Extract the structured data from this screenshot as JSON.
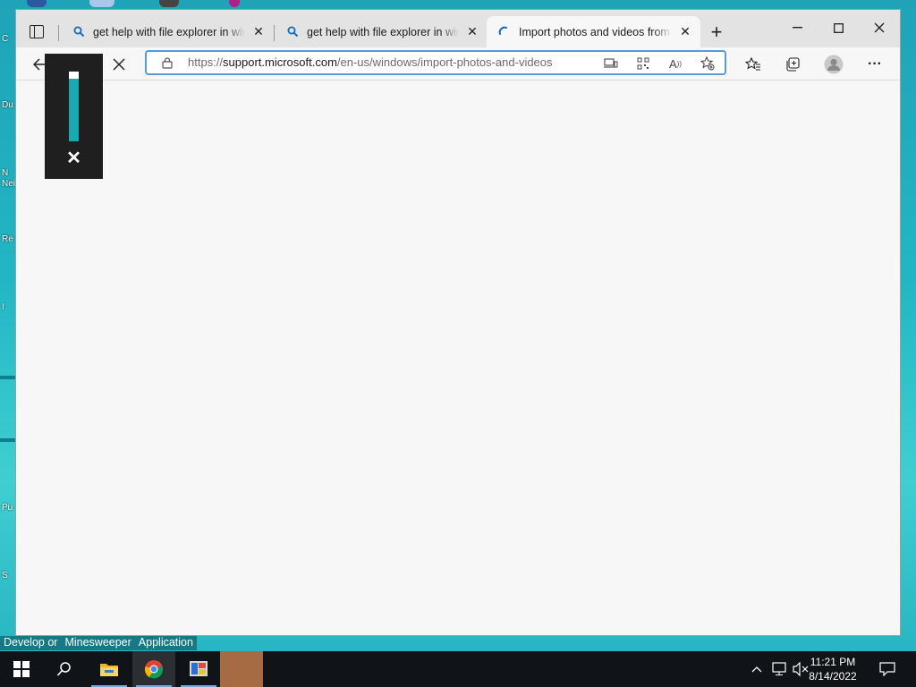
{
  "tabs": [
    {
      "title": "get help with file explorer in windows",
      "state": "inactive"
    },
    {
      "title": "get help with file explorer in windows",
      "state": "inactive"
    },
    {
      "title": "Import photos and videos from a phone",
      "state": "active-loading"
    }
  ],
  "address": {
    "prefix": "https://",
    "domain": "support.microsoft.com",
    "path": "/en-us/windows/import-photos-and-videos"
  },
  "volume": {
    "level": 0.9,
    "muted": true
  },
  "desktop_labels": [
    "Develop or",
    "Minesweeper",
    "Application"
  ],
  "side_labels": [
    "C",
    "Du",
    "N",
    "Nei",
    "Re",
    "I",
    "Pu",
    "S"
  ],
  "clock": {
    "time": "11:21 PM",
    "date": "8/14/2022"
  },
  "colors": {
    "accent": "#5b9bd5",
    "volume_fill": "#1aa9b0",
    "taskbar": "#101418"
  }
}
